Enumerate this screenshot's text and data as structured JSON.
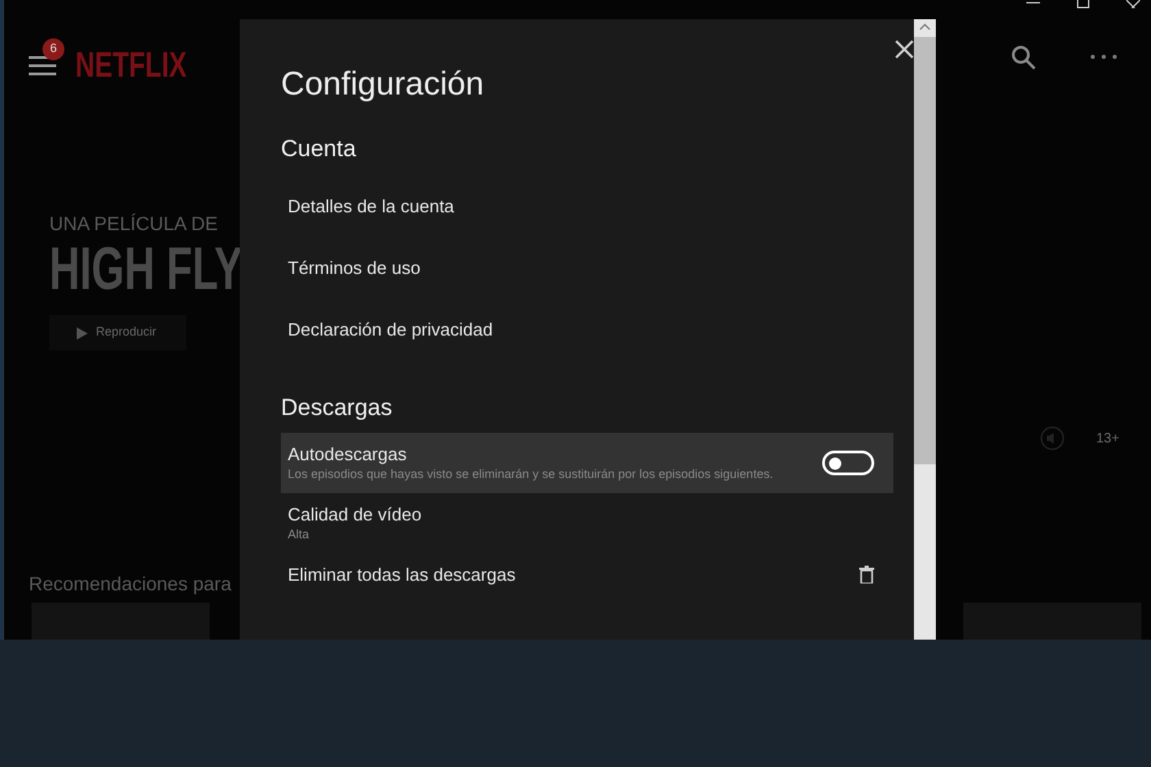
{
  "app": {
    "menu_badge": "6",
    "logo": "NETFLIX",
    "hero": {
      "eyebrow": "UNA PELÍCULA DE",
      "title": "HIGH FLY",
      "play_label": "Reproducir",
      "rating": "13+"
    },
    "row_title": "Recomendaciones para"
  },
  "settings": {
    "title": "Configuración",
    "sections": [
      {
        "heading": "Cuenta",
        "items": [
          {
            "kind": "link",
            "label": "Detalles de la cuenta",
            "highlighted": false
          },
          {
            "kind": "link",
            "label": "Términos de uso",
            "highlighted": false
          },
          {
            "kind": "link",
            "label": "Declaración de privacidad",
            "highlighted": false
          }
        ]
      },
      {
        "heading": "Descargas",
        "items": [
          {
            "kind": "toggle",
            "label": "Autodescargas",
            "description": "Los episodios que hayas visto se eliminarán y se sustituirán por los episodios siguientes.",
            "on": false,
            "highlighted": true
          },
          {
            "kind": "value",
            "label": "Calidad de vídeo",
            "description": "Alta",
            "highlighted": false
          },
          {
            "kind": "action",
            "label": "Eliminar todas las descargas",
            "highlighted": false
          }
        ]
      }
    ]
  }
}
